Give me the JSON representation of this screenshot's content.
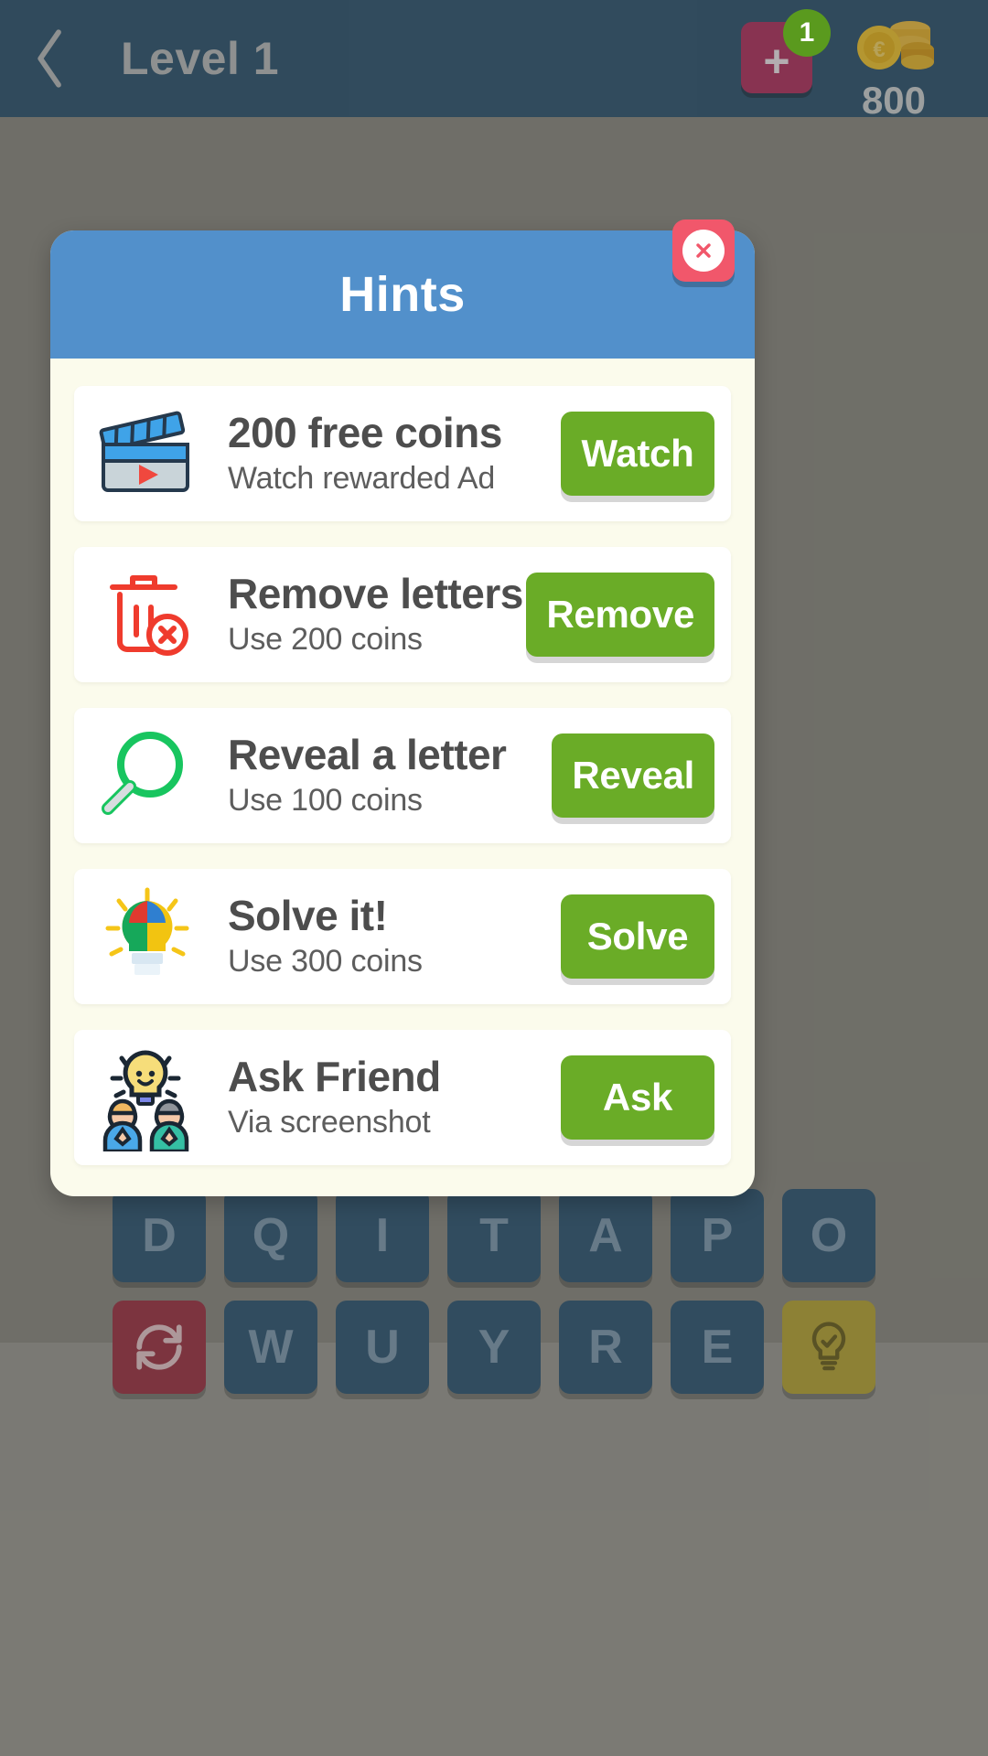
{
  "topbar": {
    "back_icon": "chevron-left-icon",
    "title": "Level 1",
    "add_life_plus": "+",
    "life_badge_count": "1",
    "coin_count": "800",
    "coin_icon": "coin-stack-icon"
  },
  "dialog": {
    "title": "Hints",
    "close_icon": "close-icon",
    "header_color": "#5290cb",
    "body_color": "#fbfbec",
    "button_color": "#6aac27",
    "close_color": "#f1576b",
    "hints": [
      {
        "icon": "clapperboard-video-icon",
        "title": "200 free coins",
        "subtitle": "Watch rewarded Ad",
        "action": "Watch"
      },
      {
        "icon": "trash-delete-icon",
        "title": "Remove letters",
        "subtitle": "Use 200 coins",
        "action": "Remove"
      },
      {
        "icon": "magnifier-search-icon",
        "title": "Reveal a letter",
        "subtitle": "Use 100 coins",
        "action": "Reveal"
      },
      {
        "icon": "lightbulb-puzzle-icon",
        "title": "Solve it!",
        "subtitle": "Use 300 coins",
        "action": "Solve"
      },
      {
        "icon": "friends-lightbulb-icon",
        "title": "Ask Friend",
        "subtitle": "Via screenshot",
        "action": "Ask"
      }
    ]
  },
  "keyboard": {
    "row1": [
      "D",
      "Q",
      "I",
      "T",
      "A",
      "P",
      "O"
    ],
    "row2_shuffle_icon": "shuffle-refresh-icon",
    "row2": [
      "W",
      "U",
      "Y",
      "R",
      "E"
    ],
    "row2_hint_icon": "lightbulb-hint-icon"
  }
}
